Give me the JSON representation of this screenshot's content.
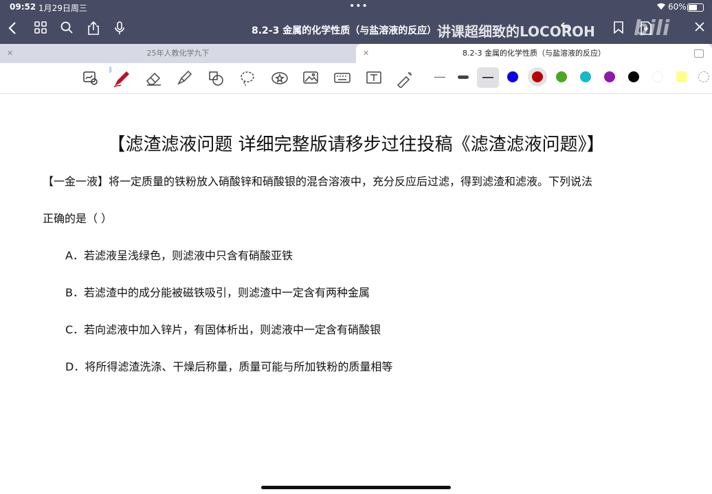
{
  "status": {
    "time": "09:52",
    "date": "1月29日周三",
    "battery": "60%"
  },
  "nav": {
    "title": "8.2-3 金属的化学性质（与盐溶液的反应）"
  },
  "watermark": {
    "text": "讲课超细致的LOCOROH",
    "logo": "bilibili"
  },
  "tabs": [
    {
      "label": "25年人教化学九下"
    },
    {
      "label": "8.2-3 金属的化学性质（与盐溶液的反应）"
    }
  ],
  "colors": {
    "header": "#474b63",
    "swatches": [
      "#0b00e6",
      "#b80000",
      "#4ca623",
      "#16b8c9",
      "#8e1aa8",
      "#050505",
      "#ffffff",
      "#ffff8c"
    ]
  },
  "document": {
    "heading": "【滤渣滤液问题  详细完整版请移步过往投稿《滤渣滤液问题》】",
    "question_line1": "【一金一液】将一定质量的铁粉放入硝酸锌和硝酸银的混合溶液中，充分反应后过滤，得到滤渣和滤液。下列说法",
    "question_line2": "正确的是（          ）",
    "options": [
      "A．若滤液呈浅绿色，则滤液中只含有硝酸亚铁",
      "B．若滤渣中的成分能被磁铁吸引，则滤渣中一定含有两种金属",
      "C．若向滤液中加入锌片，有固体析出，则滤液中一定含有硝酸银",
      "D．将所得滤渣洗涤、干燥后称量，质量可能与所加铁粉的质量相等"
    ]
  }
}
